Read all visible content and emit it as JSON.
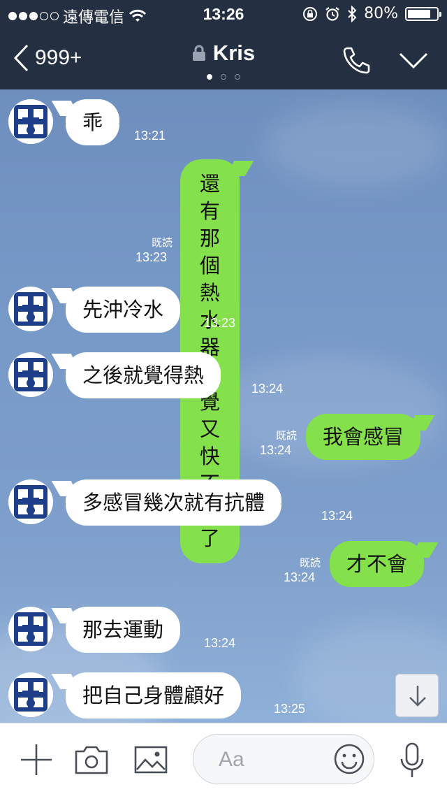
{
  "status": {
    "carrier": "遠傳電信",
    "time": "13:26",
    "battery": "80%",
    "battery_level": 0.8
  },
  "header": {
    "back_count": "999+",
    "title": "Kris",
    "lock_icon": "lock-icon",
    "call_icon": "phone-icon",
    "menu_icon": "chevron-down-icon"
  },
  "messages": [
    {
      "side": "in",
      "text": "乖",
      "time": "13:21"
    },
    {
      "side": "out",
      "text": "還有那個\n熱水器 感覺又快不熱\n了",
      "time": "13:23",
      "read": "既読"
    },
    {
      "side": "in",
      "text": "先沖冷水",
      "time": "13:23"
    },
    {
      "side": "in",
      "text": "之後就覺得熱",
      "time": "13:24"
    },
    {
      "side": "out",
      "text": "我會感冒",
      "time": "13:24",
      "read": "既読"
    },
    {
      "side": "in",
      "text": "多感冒幾次就有抗體",
      "time": "13:24"
    },
    {
      "side": "out",
      "text": "才不會",
      "time": "13:24",
      "read": "既読"
    },
    {
      "side": "in",
      "text": "那去運動",
      "time": "13:24"
    },
    {
      "side": "in",
      "text": "把自己身體顧好",
      "time": "13:25"
    }
  ],
  "input": {
    "placeholder": "Aa"
  },
  "colors": {
    "header_bg": "#243042",
    "outgoing_bubble": "#84e04b",
    "incoming_bubble": "#ffffff",
    "chat_bg": "#7799c8"
  }
}
